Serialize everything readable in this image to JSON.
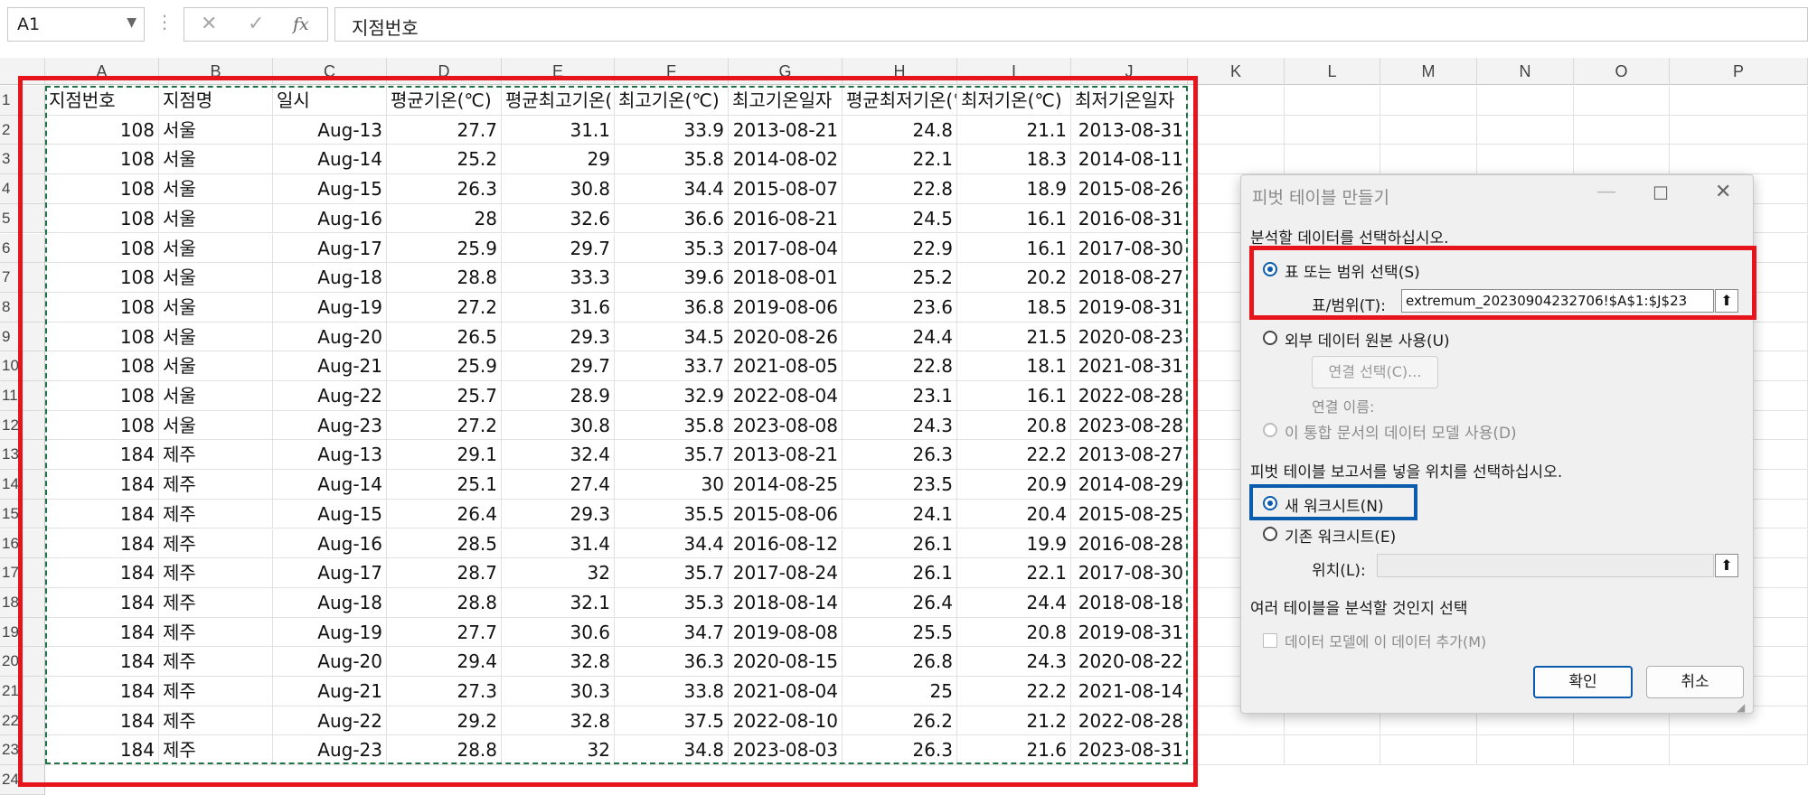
{
  "formula_bar": {
    "name_box": "A1",
    "cancel_icon": "✕",
    "enter_icon": "✓",
    "fx_label": "fx",
    "content": "지점번호"
  },
  "columns": [
    "A",
    "B",
    "C",
    "D",
    "E",
    "F",
    "G",
    "H",
    "I",
    "J",
    "K",
    "L",
    "M",
    "N",
    "O",
    "P"
  ],
  "header_row": [
    "지점번호",
    "지점명",
    "일시",
    "평균기온(℃)",
    "평균최고기온(℃)",
    "최고기온(℃)",
    "최고기온일자",
    "평균최저기온(℃)",
    "최저기온(℃)",
    "최저기온일자"
  ],
  "rows": [
    [
      "108",
      "서울",
      "Aug-13",
      "27.7",
      "31.1",
      "33.9",
      "2013-08-21",
      "24.8",
      "21.1",
      "2013-08-31"
    ],
    [
      "108",
      "서울",
      "Aug-14",
      "25.2",
      "29",
      "35.8",
      "2014-08-02",
      "22.1",
      "18.3",
      "2014-08-11"
    ],
    [
      "108",
      "서울",
      "Aug-15",
      "26.3",
      "30.8",
      "34.4",
      "2015-08-07",
      "22.8",
      "18.9",
      "2015-08-26"
    ],
    [
      "108",
      "서울",
      "Aug-16",
      "28",
      "32.6",
      "36.6",
      "2016-08-21",
      "24.5",
      "16.1",
      "2016-08-31"
    ],
    [
      "108",
      "서울",
      "Aug-17",
      "25.9",
      "29.7",
      "35.3",
      "2017-08-04",
      "22.9",
      "16.1",
      "2017-08-30"
    ],
    [
      "108",
      "서울",
      "Aug-18",
      "28.8",
      "33.3",
      "39.6",
      "2018-08-01",
      "25.2",
      "20.2",
      "2018-08-27"
    ],
    [
      "108",
      "서울",
      "Aug-19",
      "27.2",
      "31.6",
      "36.8",
      "2019-08-06",
      "23.6",
      "18.5",
      "2019-08-31"
    ],
    [
      "108",
      "서울",
      "Aug-20",
      "26.5",
      "29.3",
      "34.5",
      "2020-08-26",
      "24.4",
      "21.5",
      "2020-08-23"
    ],
    [
      "108",
      "서울",
      "Aug-21",
      "25.9",
      "29.7",
      "33.7",
      "2021-08-05",
      "22.8",
      "18.1",
      "2021-08-31"
    ],
    [
      "108",
      "서울",
      "Aug-22",
      "25.7",
      "28.9",
      "32.9",
      "2022-08-04",
      "23.1",
      "16.1",
      "2022-08-28"
    ],
    [
      "108",
      "서울",
      "Aug-23",
      "27.2",
      "30.8",
      "35.8",
      "2023-08-08",
      "24.3",
      "20.8",
      "2023-08-28"
    ],
    [
      "184",
      "제주",
      "Aug-13",
      "29.1",
      "32.4",
      "35.7",
      "2013-08-21",
      "26.3",
      "22.2",
      "2013-08-27"
    ],
    [
      "184",
      "제주",
      "Aug-14",
      "25.1",
      "27.4",
      "30",
      "2014-08-25",
      "23.5",
      "20.9",
      "2014-08-29"
    ],
    [
      "184",
      "제주",
      "Aug-15",
      "26.4",
      "29.3",
      "35.5",
      "2015-08-06",
      "24.1",
      "20.4",
      "2015-08-25"
    ],
    [
      "184",
      "제주",
      "Aug-16",
      "28.5",
      "31.4",
      "34.4",
      "2016-08-12",
      "26.1",
      "19.9",
      "2016-08-28"
    ],
    [
      "184",
      "제주",
      "Aug-17",
      "28.7",
      "32",
      "35.7",
      "2017-08-24",
      "26.1",
      "22.1",
      "2017-08-30"
    ],
    [
      "184",
      "제주",
      "Aug-18",
      "28.8",
      "32.1",
      "35.3",
      "2018-08-14",
      "26.4",
      "24.4",
      "2018-08-18"
    ],
    [
      "184",
      "제주",
      "Aug-19",
      "27.7",
      "30.6",
      "34.7",
      "2019-08-08",
      "25.5",
      "20.8",
      "2019-08-31"
    ],
    [
      "184",
      "제주",
      "Aug-20",
      "29.4",
      "32.8",
      "36.3",
      "2020-08-15",
      "26.8",
      "24.3",
      "2020-08-22"
    ],
    [
      "184",
      "제주",
      "Aug-21",
      "27.3",
      "30.3",
      "33.8",
      "2021-08-04",
      "25",
      "22.2",
      "2021-08-14"
    ],
    [
      "184",
      "제주",
      "Aug-22",
      "29.2",
      "32.8",
      "37.5",
      "2022-08-10",
      "26.2",
      "21.2",
      "2022-08-28"
    ],
    [
      "184",
      "제주",
      "Aug-23",
      "28.8",
      "32",
      "34.8",
      "2023-08-03",
      "26.3",
      "21.6",
      "2023-08-31"
    ]
  ],
  "dialog": {
    "title": "피벗 테이블 만들기",
    "section1": "분석할 데이터를 선택하십시오.",
    "opt_range": "표 또는 범위 선택(S)",
    "range_label": "표/범위(T):",
    "range_value": "extremum_20230904232706!$A$1:$J$23",
    "opt_external": "외부 데이터 원본 사용(U)",
    "choose_conn": "연결 선택(C)...",
    "conn_name": "연결 이름:",
    "opt_model": "이 통합 문서의 데이터 모델 사용(D)",
    "section2": "피벗 테이블 보고서를 넣을 위치를 선택하십시오.",
    "opt_new": "새 워크시트(N)",
    "opt_existing": "기존 워크시트(E)",
    "location_label": "위치(L):",
    "section3": "여러 테이블을 분석할 것인지 선택",
    "add_model": "데이터 모델에 이 데이터 추가(M)",
    "ok": "확인",
    "cancel": "취소"
  }
}
